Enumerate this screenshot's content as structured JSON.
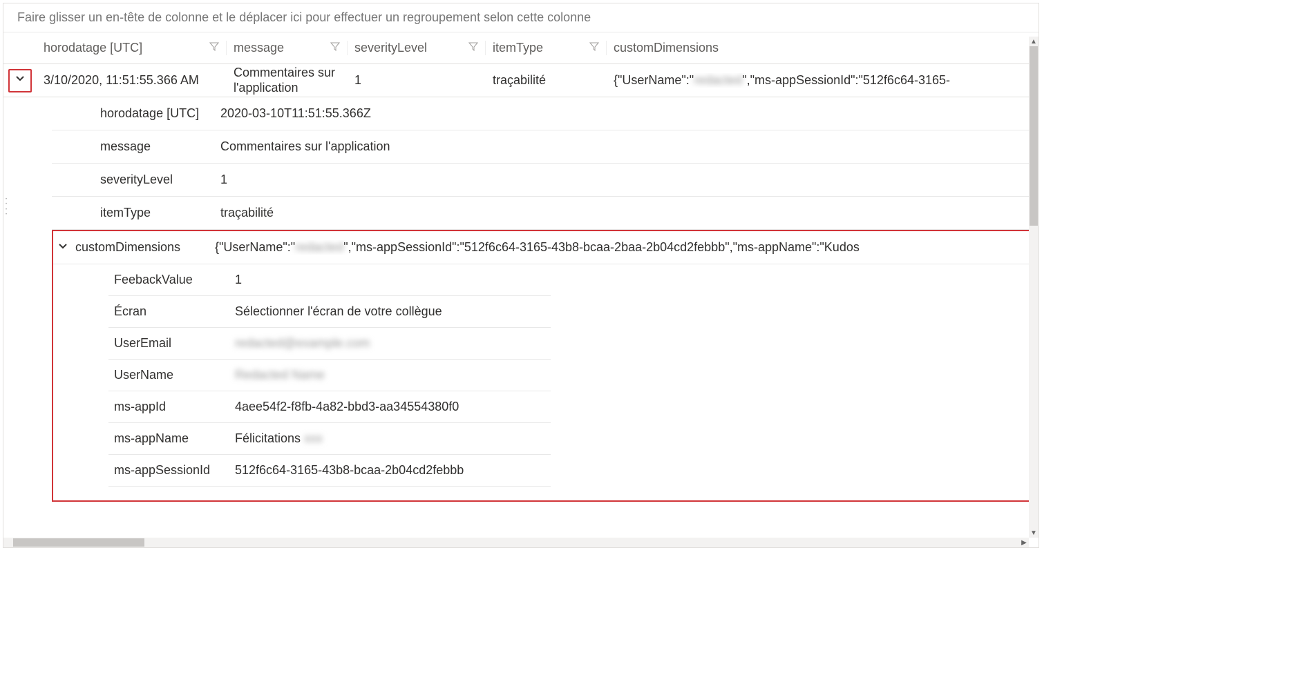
{
  "groupHint": "Faire glisser un en-tête de colonne et le déplacer ici pour effectuer un regroupement selon cette colonne",
  "columns": {
    "timestamp": "horodatage [UTC]",
    "message": "message",
    "severity": "severityLevel",
    "itemType": "itemType",
    "custom": "customDimensions"
  },
  "row": {
    "timestamp": "3/10/2020, 11:51:55.366 AM",
    "message": "Commentaires sur l'application",
    "severity": "1",
    "itemType": "traçabilité",
    "customPrefix": "{\"UserName\":\"",
    "customRedacted": "redacted",
    "customSuffix": "\",\"ms-appSessionId\":\"512f6c64-3165-"
  },
  "details": {
    "timestamp_key": "horodatage [UTC]",
    "timestamp_val": "2020-03-10T11:51:55.366Z",
    "message_key": "message",
    "message_val": "Commentaires sur l'application",
    "severity_key": "severityLevel",
    "severity_val": "1",
    "itemType_key": "itemType",
    "itemType_val": "traçabilité",
    "custom_key": "customDimensions",
    "custom_val_prefix": "{\"UserName\":\"",
    "custom_val_redacted": "redacted",
    "custom_val_suffix": "\",\"ms-appSessionId\":\"512f6c64-3165-43b8-bcaa-2baa-2b04cd2febbb\",\"ms-appName\":\"Kudos"
  },
  "customDims": [
    {
      "key": "FeebackValue",
      "val": "1"
    },
    {
      "key": "Écran",
      "val": "Sélectionner l'écran de votre collègue"
    },
    {
      "key": "UserEmail",
      "val": "redacted@example.com",
      "blur": true
    },
    {
      "key": "UserName",
      "val": "Redacted Name",
      "blur": true
    },
    {
      "key": "ms-appId",
      "val": "4aee54f2-f8fb-4a82-bbd3-aa34554380f0"
    },
    {
      "key": "ms-appName",
      "val": "Félicitations",
      "partialBlur": true
    },
    {
      "key": "ms-appSessionId",
      "val": "512f6c64-3165-43b8-bcaa-2b04cd2febbb"
    }
  ]
}
